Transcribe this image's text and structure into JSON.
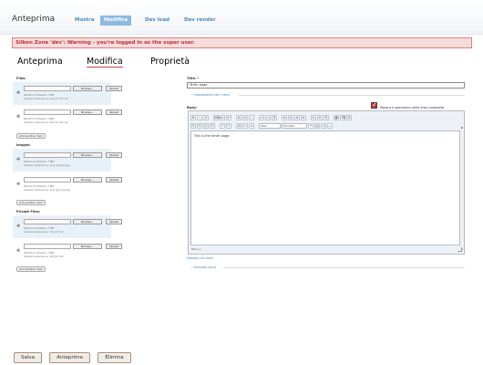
{
  "app": {
    "title": "Anteprima"
  },
  "nav": {
    "tabs": [
      "Mostra",
      "Modifica",
      "Dev load",
      "Dev render"
    ],
    "active": "Modifica"
  },
  "alert": {
    "text": "Silken Zone 'dev': Warning - you're logged in as the super user."
  },
  "subtabs": {
    "items": [
      "Anteprima",
      "Modifica",
      "Proprietà"
    ],
    "active": "Modifica"
  },
  "files": {
    "label": "Files:",
    "items": [
      {
        "browse": "Browse...",
        "upload": "Upload",
        "meta1": "Maximum filesize: 2 MB",
        "meta2": "Allowed extensions: txt pdf doc xls"
      },
      {
        "browse": "Browse...",
        "upload": "Upload",
        "meta1": "Maximum filesize: 2 MB",
        "meta2": "Allowed extensions: txt pdf doc xls"
      }
    ],
    "add_label": "Add another item"
  },
  "images": {
    "label": "Images:",
    "items": [
      {
        "browse": "Browse...",
        "upload": "Upload",
        "meta1": "Maximum filesize: 2 MB",
        "meta2": "Allowed extensions: png gif jpg jpeg"
      },
      {
        "browse": "Browse...",
        "upload": "Upload",
        "meta1": "Maximum filesize: 2 MB",
        "meta2": "Allowed extensions: png gif jpg jpeg"
      }
    ],
    "add_label": "Add another item"
  },
  "private_files": {
    "label": "Private Files:",
    "items": [
      {
        "browse": "Browse...",
        "upload": "Upload",
        "meta1": "Maximum filesize: 2 MB",
        "meta2": "Allowed extensions: txt pdf doc"
      },
      {
        "browse": "Browse...",
        "upload": "Upload",
        "meta1": "Maximum filesize: 2 MB",
        "meta2": "Allowed extensions: txt pdf doc"
      }
    ],
    "add_label": "Add another item"
  },
  "title_field": {
    "label": "Title: *",
    "value": "Tenth page"
  },
  "menu_settings": {
    "label": "Impostazioni dei menu"
  },
  "body_field": {
    "label": "Body:",
    "checkbox_label": "Mostra il sommario nella vista completa",
    "content": "This is the tenth page.",
    "path_label": "Path: p",
    "disable_editor": "Disable rich-text",
    "input_format": "Formato input"
  },
  "toolbar": {
    "row1": [
      "B",
      "I",
      "U",
      "ABC",
      "x₂",
      "x²",
      "≡",
      "≡",
      "—",
      "⤺",
      "⤻",
      "¶",
      "≡",
      "≡",
      "≡",
      "≡",
      "A",
      "A",
      "¶",
      "▦",
      "⌫",
      "Ω"
    ],
    "row2": [
      "⎘",
      "⎘",
      "⎘",
      "⎘",
      "↶",
      "↷",
      "🔗",
      "✂",
      "⚓",
      "❝",
      "☺",
      "▭",
      "—"
    ],
    "selects": [
      "Stile",
      "Formato"
    ]
  },
  "footer": {
    "save": "Salva",
    "preview": "Anteprima",
    "delete": "Elimina"
  }
}
